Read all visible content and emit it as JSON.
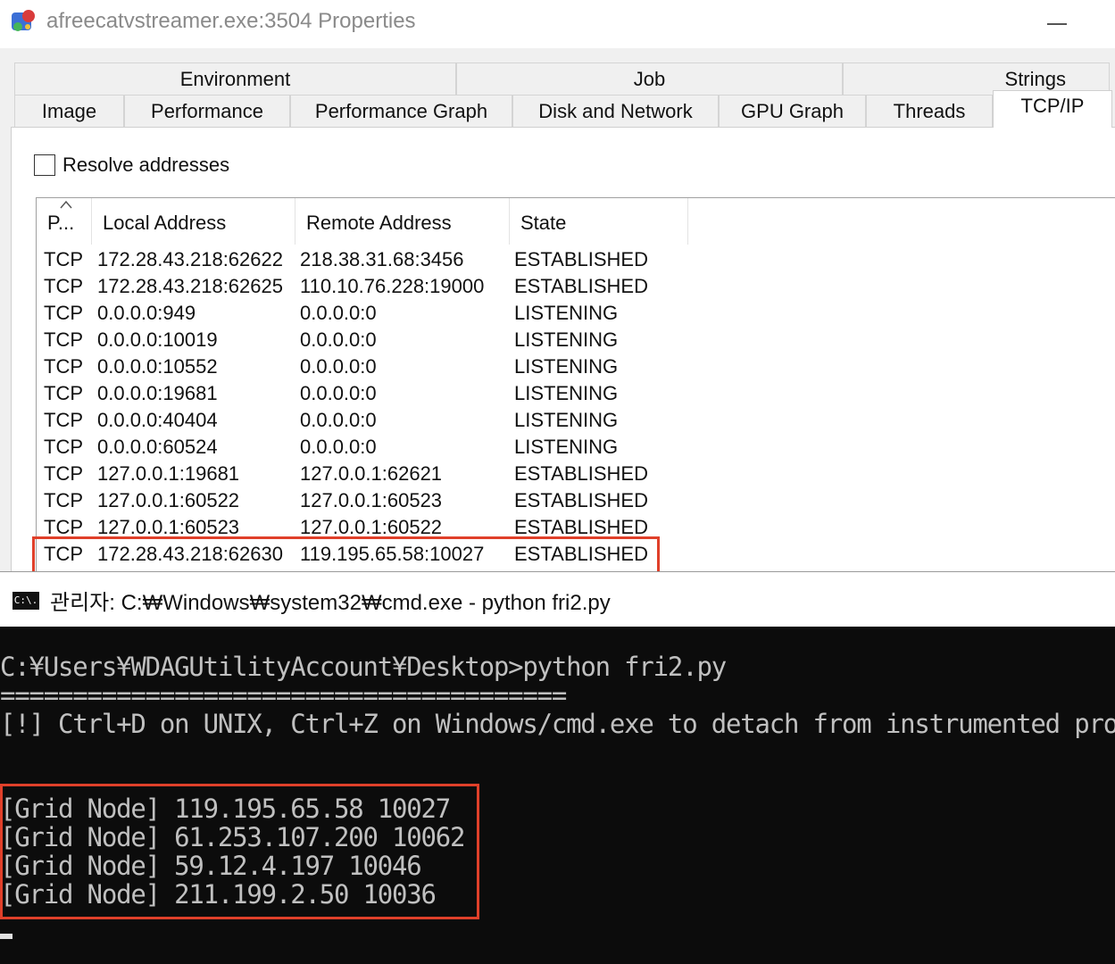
{
  "window": {
    "title": "afreecatvstreamer.exe:3504 Properties"
  },
  "tabs_row1": [
    {
      "label": "Environment"
    },
    {
      "label": "Job"
    },
    {
      "label": "Strings"
    }
  ],
  "tabs_row2": [
    {
      "label": "Image"
    },
    {
      "label": "Performance"
    },
    {
      "label": "Performance Graph"
    },
    {
      "label": "Disk and Network"
    },
    {
      "label": "GPU Graph"
    },
    {
      "label": "Threads"
    },
    {
      "label": "TCP/IP",
      "active": true
    }
  ],
  "resolve": {
    "label": "Resolve addresses",
    "checked": false
  },
  "table": {
    "headers": [
      "P...",
      "Local Address",
      "Remote Address",
      "State"
    ],
    "rows": [
      [
        "TCP",
        "172.28.43.218:62622",
        "218.38.31.68:3456",
        "ESTABLISHED"
      ],
      [
        "TCP",
        "172.28.43.218:62625",
        "110.10.76.228:19000",
        "ESTABLISHED"
      ],
      [
        "TCP",
        "0.0.0.0:949",
        "0.0.0.0:0",
        "LISTENING"
      ],
      [
        "TCP",
        "0.0.0.0:10019",
        "0.0.0.0:0",
        "LISTENING"
      ],
      [
        "TCP",
        "0.0.0.0:10552",
        "0.0.0.0:0",
        "LISTENING"
      ],
      [
        "TCP",
        "0.0.0.0:19681",
        "0.0.0.0:0",
        "LISTENING"
      ],
      [
        "TCP",
        "0.0.0.0:40404",
        "0.0.0.0:0",
        "LISTENING"
      ],
      [
        "TCP",
        "0.0.0.0:60524",
        "0.0.0.0:0",
        "LISTENING"
      ],
      [
        "TCP",
        "127.0.0.1:19681",
        "127.0.0.1:62621",
        "ESTABLISHED"
      ],
      [
        "TCP",
        "127.0.0.1:60522",
        "127.0.0.1:60523",
        "ESTABLISHED"
      ],
      [
        "TCP",
        "127.0.0.1:60523",
        "127.0.0.1:60522",
        "ESTABLISHED"
      ],
      [
        "TCP",
        "172.28.43.218:62630",
        "119.195.65.58:10027",
        "ESTABLISHED"
      ]
    ]
  },
  "cmd": {
    "title": "관리자: C:₩Windows₩system32₩cmd.exe - python  fri2.py",
    "icon_text": "C:\\.",
    "lines": [
      "C:¥Users¥WDAGUtilityAccount¥Desktop>python fri2.py",
      "=======================================",
      "[!] Ctrl+D on UNIX, Ctrl+Z on Windows/cmd.exe to detach from instrumented prog",
      "",
      "",
      "[Grid Node] 119.195.65.58 10027",
      "[Grid Node] 61.253.107.200 10062",
      "[Grid Node] 59.12.4.197 10046",
      "[Grid Node] 211.199.2.50 10036"
    ]
  },
  "colors": {
    "highlight_box": "#e0402a",
    "terminal_bg": "#0c0c0c",
    "terminal_fg": "#c0c0c0"
  }
}
